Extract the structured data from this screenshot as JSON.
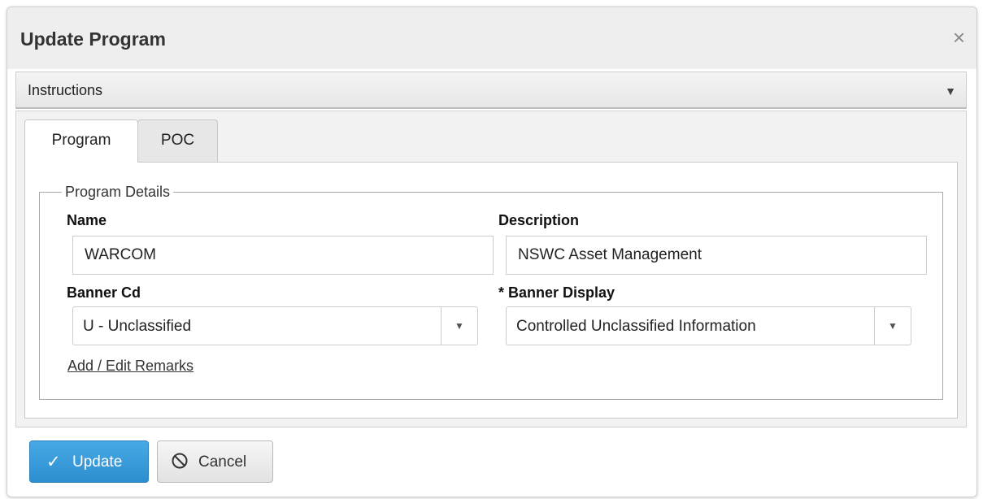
{
  "dialog": {
    "title": "Update Program",
    "close_glyph": "×"
  },
  "instructions": {
    "label": "Instructions",
    "caret_glyph": "▼"
  },
  "tabs": [
    {
      "label": "Program",
      "active": true
    },
    {
      "label": "POC",
      "active": false
    }
  ],
  "program_details": {
    "legend": "Program Details",
    "name": {
      "label": "Name",
      "value": "WARCOM"
    },
    "description": {
      "label": "Description",
      "value": "NSWC Asset Management"
    },
    "banner_cd": {
      "label": "Banner Cd",
      "value": "U - Unclassified"
    },
    "banner_display": {
      "label": "* Banner Display",
      "value": "Controlled Unclassified Information"
    },
    "remarks_link": "Add / Edit Remarks"
  },
  "buttons": {
    "update": {
      "label": "Update",
      "icon": "checkmark-icon",
      "glyph": "✓"
    },
    "cancel": {
      "label": "Cancel",
      "icon": "cancel-circle-icon",
      "glyph": "⃠"
    }
  },
  "colors": {
    "primary_button": "#2d8ecf",
    "header_bg": "#eeeeee"
  }
}
